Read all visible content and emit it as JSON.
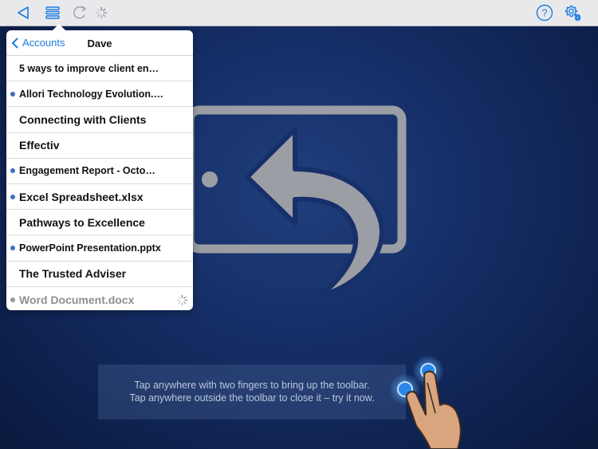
{
  "popover": {
    "back_label": "Accounts",
    "title": "Dave",
    "items": [
      {
        "label": "5 ways to improve client en…",
        "dot": false,
        "style": "small"
      },
      {
        "label": "Allori Technology Evolution.…",
        "dot": true,
        "style": "small"
      },
      {
        "label": "Connecting with Clients",
        "dot": false,
        "style": "big"
      },
      {
        "label": "Effectiv",
        "dot": false,
        "style": "big"
      },
      {
        "label": "Engagement Report - Octo…",
        "dot": true,
        "style": "small"
      },
      {
        "label": "Excel Spreadsheet.xlsx",
        "dot": true,
        "style": "big"
      },
      {
        "label": "Pathways to Excellence",
        "dot": false,
        "style": "big"
      },
      {
        "label": "PowerPoint Presentation.pptx",
        "dot": true,
        "style": "small"
      },
      {
        "label": "The Trusted Adviser",
        "dot": false,
        "style": "big"
      },
      {
        "label": "Word Document.docx",
        "dot": true,
        "style": "big",
        "loading": true
      }
    ]
  },
  "hint": {
    "line1": "Tap anywhere with two fingers to bring up the toolbar.",
    "line2": "Tap anywhere outside the toolbar to close it – try it now."
  },
  "icons": {
    "back": "back-triangle-icon",
    "menu": "list-menu-icon",
    "refresh": "refresh-icon",
    "help": "help-circle-icon",
    "settings": "gear-icon",
    "large_graphic": "tablet-return-arrow-icon",
    "gesture": "two-finger-tap-hand-icon"
  },
  "colors": {
    "accent": "#1a7ee0",
    "unread_dot": "#3f6fbf",
    "background": "#17306a"
  }
}
